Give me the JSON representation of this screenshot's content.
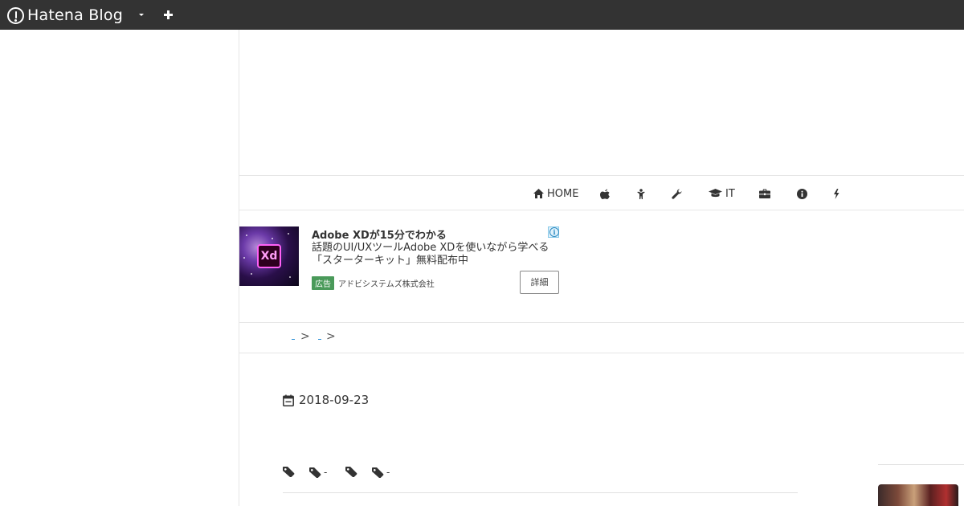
{
  "topbar": {
    "brand": "Hatena Blog"
  },
  "nav": {
    "items": [
      {
        "label": "HOME",
        "icon": "home-icon"
      },
      {
        "label": "",
        "icon": "apple-icon"
      },
      {
        "label": "",
        "icon": "person-icon"
      },
      {
        "label": "",
        "icon": "wrench-icon"
      },
      {
        "label": "IT",
        "icon": "graduation-cap-icon"
      },
      {
        "label": "",
        "icon": "briefcase-icon"
      },
      {
        "label": "",
        "icon": "info-icon"
      },
      {
        "label": "",
        "icon": "bolt-icon"
      }
    ]
  },
  "ad": {
    "title": "Adobe XDが15分でわかる",
    "description_line1": "話題のUI/UXツールAdobe XDを使いながら学べる",
    "description_line2": "「スターターキット」無料配布中",
    "badge": "広告",
    "advertiser": "アドビシステムズ株式会社",
    "detail_button": "詳細",
    "logo_text": "Xd"
  },
  "breadcrumb": {
    "separator": ">"
  },
  "entry": {
    "date": "2018-09-23",
    "tags": [
      "",
      "-",
      "",
      "-"
    ]
  },
  "colors": {
    "topbar": "#333333",
    "link": "#2a8fd6",
    "ad_badge": "#4a9a5a"
  }
}
